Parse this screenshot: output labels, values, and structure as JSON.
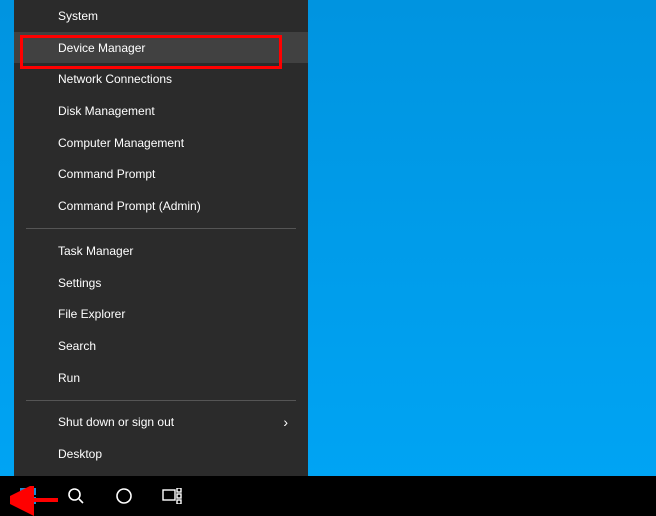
{
  "menu": {
    "groups": [
      [
        {
          "label": "System",
          "name": "menu-item-system"
        },
        {
          "label": "Device Manager",
          "name": "menu-item-device-manager",
          "hover": true
        },
        {
          "label": "Network Connections",
          "name": "menu-item-network-connections"
        },
        {
          "label": "Disk Management",
          "name": "menu-item-disk-management"
        },
        {
          "label": "Computer Management",
          "name": "menu-item-computer-management"
        },
        {
          "label": "Command Prompt",
          "name": "menu-item-command-prompt"
        },
        {
          "label": "Command Prompt (Admin)",
          "name": "menu-item-command-prompt-admin"
        }
      ],
      [
        {
          "label": "Task Manager",
          "name": "menu-item-task-manager"
        },
        {
          "label": "Settings",
          "name": "menu-item-settings"
        },
        {
          "label": "File Explorer",
          "name": "menu-item-file-explorer"
        },
        {
          "label": "Search",
          "name": "menu-item-search"
        },
        {
          "label": "Run",
          "name": "menu-item-run"
        }
      ],
      [
        {
          "label": "Shut down or sign out",
          "name": "menu-item-shutdown-signout",
          "submenu": true
        },
        {
          "label": "Desktop",
          "name": "menu-item-desktop"
        }
      ]
    ]
  },
  "taskbar": {
    "start": "start-button",
    "search": "search-button",
    "cortana": "cortana-button",
    "taskview": "task-view-button"
  },
  "annotations": {
    "highlight_color": "#ff0000"
  }
}
